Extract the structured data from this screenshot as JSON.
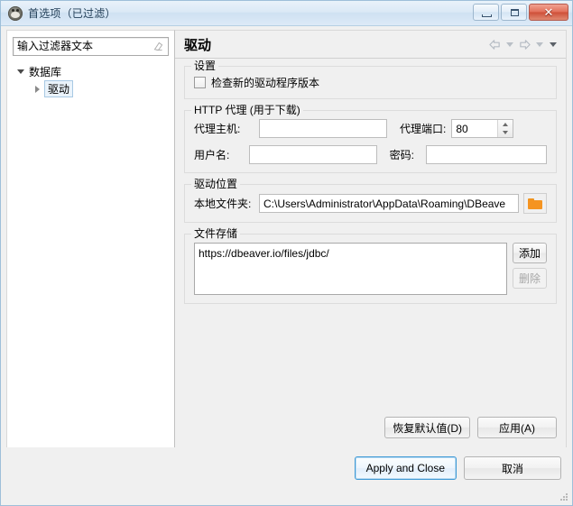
{
  "window": {
    "title": "首选项（已过滤）",
    "app_icon": "beaver-icon",
    "buttons": {
      "minimize": "minimize-icon",
      "maximize": "maximize-icon",
      "close": "✕"
    }
  },
  "sidebar": {
    "filter": {
      "placeholder": "输入过滤器文本",
      "value": "",
      "clear_icon": "erase-icon"
    },
    "tree": [
      {
        "label": "数据库",
        "expanded": true,
        "selected": false
      },
      {
        "label": "驱动",
        "expanded": false,
        "selected": true
      }
    ]
  },
  "page": {
    "title": "驱动",
    "nav": {
      "back": "back-arrow-icon",
      "back_menu": "chevron-down-icon",
      "forward": "forward-arrow-icon",
      "forward_menu": "chevron-down-icon",
      "view_menu": "chevron-down-icon"
    },
    "groups": {
      "settings": {
        "title": "设置",
        "check_new_driver_label": "检查新的驱动程序版本",
        "check_new_driver_checked": false
      },
      "proxy": {
        "title": "HTTP 代理 (用于下载)",
        "host_label": "代理主机:",
        "host_value": "",
        "port_label": "代理端口:",
        "port_value": "80",
        "user_label": "用户名:",
        "user_value": "",
        "password_label": "密码:",
        "password_value": ""
      },
      "location": {
        "title": "驱动位置",
        "local_folder_label": "本地文件夹:",
        "local_folder_value": "C:\\Users\\Administrator\\AppData\\Roaming\\DBeave",
        "browse_icon": "folder-icon"
      },
      "file_storage": {
        "title": "文件存储",
        "items": [
          "https://dbeaver.io/files/jdbc/"
        ],
        "add_label": "添加",
        "remove_label": "删除",
        "remove_disabled": true
      }
    },
    "restore_defaults_label": "恢复默认值(D)",
    "apply_label": "应用(A)"
  },
  "footer": {
    "apply_and_close_label": "Apply and Close",
    "cancel_label": "取消"
  },
  "colors": {
    "accent": "#3f9ad6",
    "folder": "#f59421",
    "close_button": "#cf4f38"
  }
}
